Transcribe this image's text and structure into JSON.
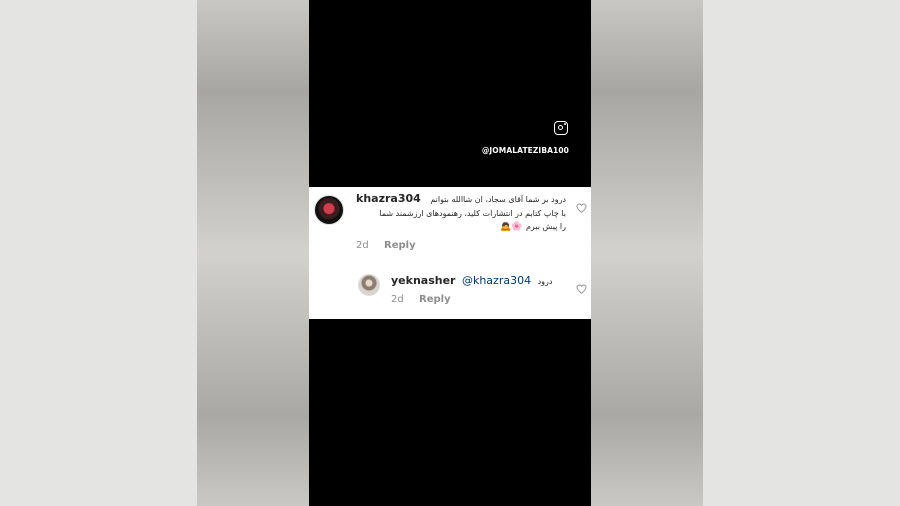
{
  "video": {
    "handle": "@JOMALATEZIBA100"
  },
  "comments": [
    {
      "username": "khazra304",
      "line1": "درود بر شما آقای سجاد، ان شاالله بتوانم",
      "line2": "با چاپ کتابم در انتشارات کلید، رهنمودهای ارزشمند شما",
      "line3": "را پیش ببرم",
      "emojis": "🌸🙇",
      "time": "2d",
      "reply_label": "Reply"
    }
  ],
  "reply": {
    "username": "yeknasher",
    "mention": "@khazra304",
    "text": "درود",
    "time": "2d",
    "reply_label": "Reply"
  },
  "icons": {
    "instagram": "instagram-icon",
    "like": "heart-outline-icon"
  },
  "colors": {
    "text": "#262626",
    "meta": "#8e8e8e",
    "mention": "#00376b",
    "video_bg": "#000000",
    "card_bg": "#ffffff"
  }
}
